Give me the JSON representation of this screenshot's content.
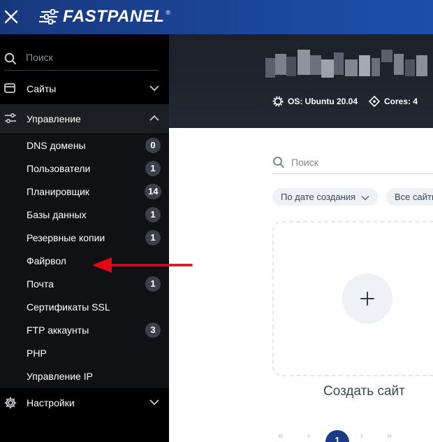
{
  "header": {
    "logo_text": "FASTPANEL",
    "logo_reg": "®",
    "close_icon": "close-icon",
    "brand_color": "#1b479b"
  },
  "sidebar": {
    "search": {
      "placeholder": "Поиск"
    },
    "sections": [
      {
        "label": "Сайты",
        "icon": "browser-window-icon",
        "expanded": false
      },
      {
        "label": "Управление",
        "icon": "sliders-icon",
        "expanded": true
      },
      {
        "label": "Настройки",
        "icon": "gear-icon",
        "expanded": false
      }
    ],
    "management_items": [
      {
        "label": "DNS домены",
        "badge": "0"
      },
      {
        "label": "Пользователи",
        "badge": "1"
      },
      {
        "label": "Планировщик",
        "badge": "14"
      },
      {
        "label": "Базы данных",
        "badge": "1"
      },
      {
        "label": "Резервные копии",
        "badge": "1"
      },
      {
        "label": "Файрвол",
        "badge": ""
      },
      {
        "label": "Почта",
        "badge": "1"
      },
      {
        "label": "Сертификаты SSL",
        "badge": ""
      },
      {
        "label": "FTP аккаунты",
        "badge": "3"
      },
      {
        "label": "PHP",
        "badge": ""
      },
      {
        "label": "Управление IP",
        "badge": ""
      }
    ]
  },
  "hero": {
    "os": "OS: Ubuntu 20.04",
    "cores": "Cores: 4"
  },
  "main": {
    "search": {
      "placeholder": "Поиск"
    },
    "filters": [
      {
        "label": "По дате создания"
      },
      {
        "label": "Все сайты"
      }
    ],
    "create_label": "Создать сайт",
    "pagination": {
      "first": "«",
      "prev": "‹",
      "current": "1",
      "next": "›",
      "last": "»"
    }
  },
  "annotation": {
    "color": "#e30613",
    "target": "Файрвол"
  }
}
